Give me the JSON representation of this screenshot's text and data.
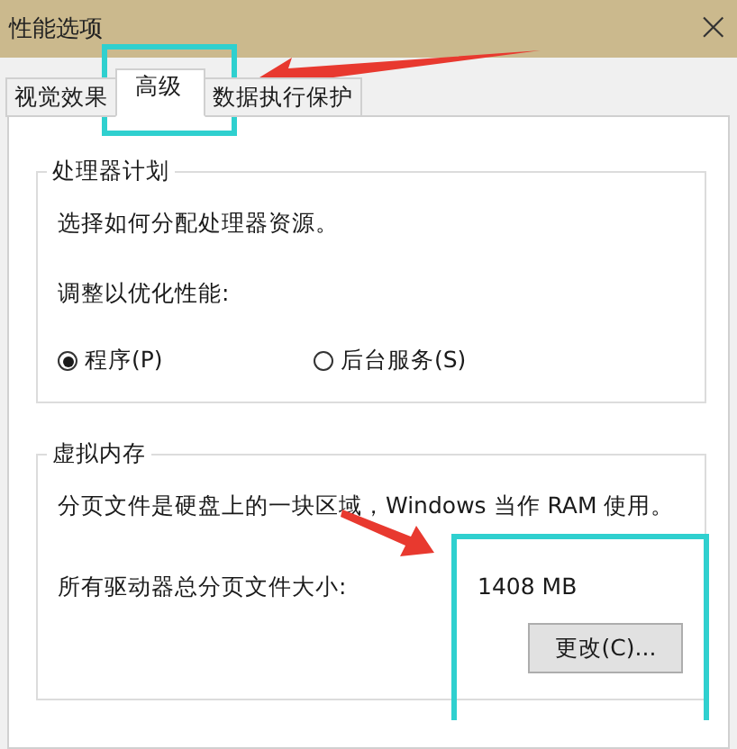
{
  "window": {
    "title": "性能选项",
    "close": "×"
  },
  "tabs": [
    {
      "label": "视觉效果",
      "selected": false
    },
    {
      "label": "高级",
      "selected": true
    },
    {
      "label": "数据执行保护",
      "selected": false
    }
  ],
  "processor_group": {
    "legend": "处理器计划",
    "description": "选择如何分配处理器资源。",
    "prompt": "调整以优化性能:",
    "options": [
      {
        "label": "程序(P)",
        "selected": true
      },
      {
        "label": "后台服务(S)",
        "selected": false
      }
    ]
  },
  "memory_group": {
    "legend": "虚拟内存",
    "description": "分页文件是硬盘上的一块区域，Windows 当作 RAM 使用。",
    "size_label": "所有驱动器总分页文件大小:",
    "size_value": "1408 MB",
    "button": "更改(C)..."
  }
}
